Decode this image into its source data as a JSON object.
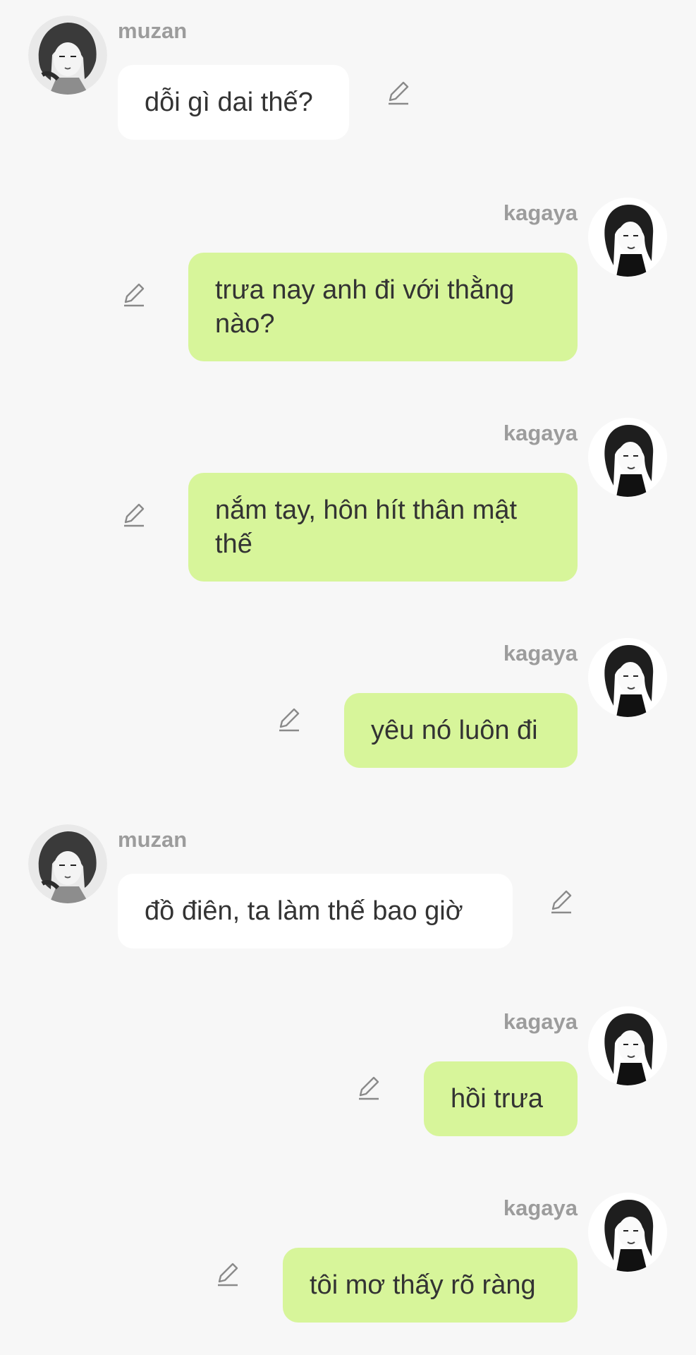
{
  "messages": [
    {
      "sender": "muzan",
      "direction": "incoming",
      "text": "dỗi gì dai thế?"
    },
    {
      "sender": "kagaya",
      "direction": "outgoing",
      "text": "trưa nay anh đi với thằng nào?"
    },
    {
      "sender": "kagaya",
      "direction": "outgoing",
      "text": "nắm tay, hôn hít thân mật thế"
    },
    {
      "sender": "kagaya",
      "direction": "outgoing",
      "text": "yêu nó luôn đi"
    },
    {
      "sender": "muzan",
      "direction": "incoming",
      "text": "đồ điên, ta làm thế bao giờ"
    },
    {
      "sender": "kagaya",
      "direction": "outgoing",
      "text": "hồi trưa"
    },
    {
      "sender": "kagaya",
      "direction": "outgoing",
      "text": "tôi mơ thấy rõ ràng"
    }
  ],
  "icons": {
    "avatar": "manga-portrait-avatar",
    "edit": "pencil-edit-icon"
  },
  "colors": {
    "background": "#f7f7f7",
    "incoming_bubble": "#ffffff",
    "outgoing_bubble": "#d7f59a",
    "sender_name": "#9c9c9c",
    "message_text": "#333333",
    "edit_icon": "#8a8a8a"
  }
}
